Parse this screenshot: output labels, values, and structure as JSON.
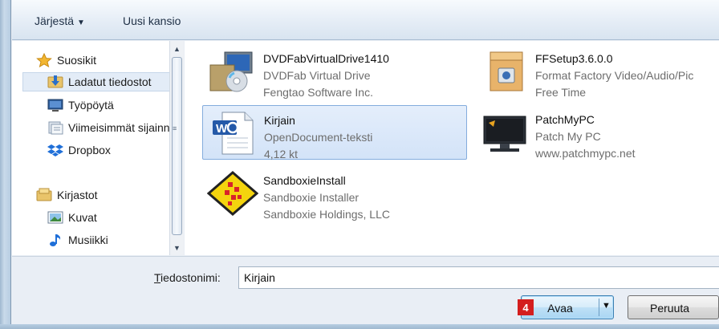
{
  "toolbar": {
    "organize_label": "Järjestä",
    "new_folder_label": "Uusi kansio"
  },
  "nav": {
    "items": [
      {
        "label": "Suosikit",
        "icon": "star-icon"
      },
      {
        "label": "Ladatut tiedostot",
        "icon": "downloads-folder-icon"
      },
      {
        "label": "Työpöytä",
        "icon": "desktop-icon"
      },
      {
        "label": "Viimeisimmät sijainnit",
        "icon": "recent-places-icon"
      },
      {
        "label": "Dropbox",
        "icon": "dropbox-icon"
      },
      {
        "label": "Kirjastot",
        "icon": "libraries-icon"
      },
      {
        "label": "Kuvat",
        "icon": "pictures-icon"
      },
      {
        "label": "Musiikki",
        "icon": "music-icon"
      }
    ]
  },
  "files": [
    {
      "name": "DVDFabVirtualDrive1410",
      "line2": "DVDFab Virtual Drive",
      "line3": "Fengtao Software Inc.",
      "icon": "installer-icon"
    },
    {
      "name": "FFSetup3.6.0.0",
      "line2": "Format Factory Video/Audio/Pic",
      "line3": "Free Time",
      "icon": "package-icon"
    },
    {
      "name": "Kirjain",
      "line2": "OpenDocument-teksti",
      "line3": "4,12 kt",
      "icon": "word-document-icon"
    },
    {
      "name": "PatchMyPC",
      "line2": "Patch My PC",
      "line3": "www.patchmypc.net",
      "icon": "monitor-icon"
    },
    {
      "name": "SandboxieInstall",
      "line2": "Sandboxie Installer",
      "line3": "Sandboxie Holdings, LLC",
      "icon": "sandboxie-icon"
    }
  ],
  "filename": {
    "label_prefix": "T",
    "label_rest": "iedostonimi:",
    "value": "Kirjain"
  },
  "buttons": {
    "open_label": "Avaa",
    "cancel_label": "Peruuta",
    "step_badge": "4"
  },
  "colors": {
    "selection": "#d3e3f8",
    "badge": "#d41e1e",
    "accent": "#3c7fb1"
  }
}
